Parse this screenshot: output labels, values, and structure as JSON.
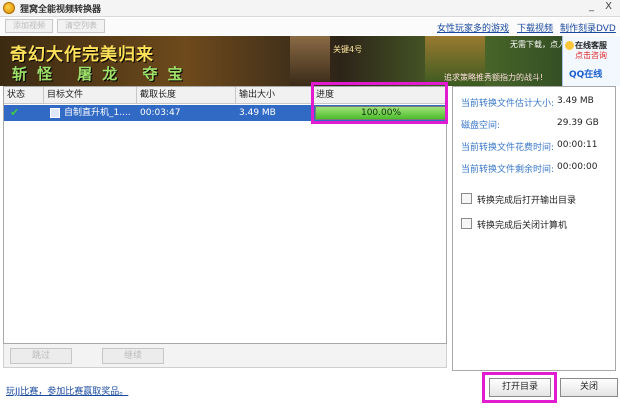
{
  "window": {
    "title": "狸窝全能视频转换器",
    "controls": [
      "_",
      "X"
    ]
  },
  "toolbar": {
    "add_video": "添加视频",
    "clear_list": "清空列表",
    "links": [
      "女性玩家多的游戏",
      "下载视频",
      "制作刻录DVD"
    ]
  },
  "banner": {
    "line1": "奇幻大作完美归来",
    "line2": "斩怪 屠龙 夺宝",
    "key_hint": "关键4号",
    "top_hint": "无需下载，点入即玩",
    "slogan": "追求策略推秀额指力的战斗!",
    "qq_line1": "在线客服",
    "qq_line2": "点击咨询",
    "qq_line3": "QQ在线"
  },
  "table": {
    "columns": [
      "状态",
      "目标文件",
      "截取长度",
      "输出大小",
      "进度"
    ],
    "rows": [
      {
        "status": "done",
        "target_file": "自制直升机_1....",
        "duration": "00:03:47",
        "size": "3.49 MB",
        "progress_pct": 100,
        "progress_text": "100.00%"
      }
    ]
  },
  "list_footer": {
    "skip": "跳过",
    "continue": "继续"
  },
  "info": {
    "est_size_label": "当前转换文件估计大小:",
    "est_size_value": "3.49 MB",
    "disk_label": "磁盘空间:",
    "disk_value": "29.39 GB",
    "elapsed_label": "当前转换文件花费时间:",
    "elapsed_value": "00:00:11",
    "remaining_label": "当前转换文件剩余时间:",
    "remaining_value": "00:00:00",
    "open_after_label": "转换完成后打开输出目录",
    "shutdown_after_label": "转换完成后关闭计算机"
  },
  "bottom": {
    "link": "玩JJ比赛，参加比赛赢取奖品。",
    "open_dir": "打开目录",
    "close": "关闭"
  },
  "colors": {
    "selection": "#316ac5",
    "highlight": "#e01bd0",
    "progress": "#4cbc2a",
    "label_blue": "#3a78c9"
  }
}
